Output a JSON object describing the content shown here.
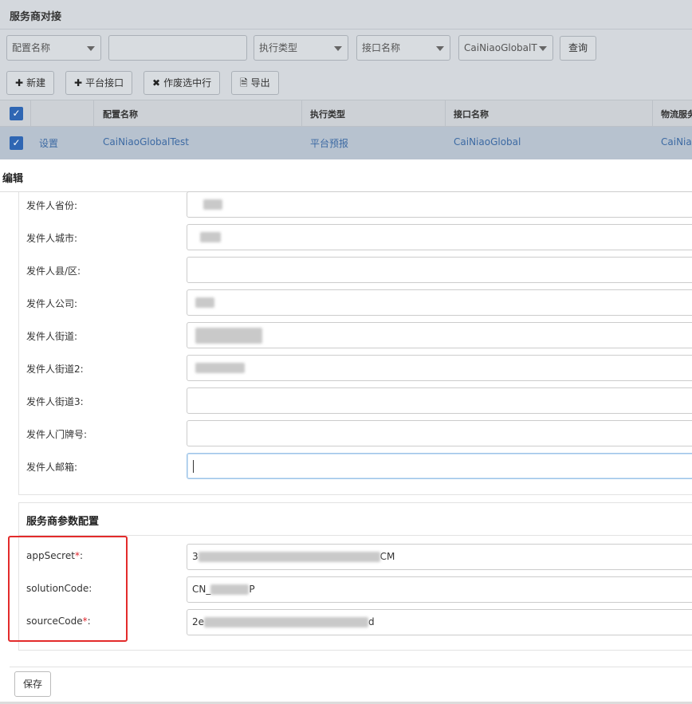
{
  "background": {
    "title": "服务商对接",
    "filters": {
      "config_name_select": "配置名称",
      "search_value": "",
      "exec_type_select": "执行类型",
      "api_name_select": "接口名称",
      "provider_select": "CaiNiaoGlobalT",
      "query_label": "查询"
    },
    "toolbar": {
      "new_label": "新建",
      "platform_api_label": "平台接口",
      "void_label": "作废选中行",
      "export_label": "导出"
    },
    "table": {
      "headers": [
        "配置名称",
        "执行类型",
        "接口名称",
        "物流服务"
      ],
      "row": {
        "action": "设置",
        "config_name": "CaiNiaoGlobalTest",
        "exec_type": "平台预报",
        "api_name": "CaiNiaoGlobal",
        "service": "CaiNia"
      }
    }
  },
  "modal": {
    "title": "编辑",
    "sender_fields": [
      {
        "label": "发件人省份:",
        "value": ""
      },
      {
        "label": "发件人城市:",
        "value": ""
      },
      {
        "label": "发件人县/区:",
        "value": ""
      },
      {
        "label": "发件人公司:",
        "value": ""
      },
      {
        "label": "发件人街道:",
        "value": ""
      },
      {
        "label": "发件人街道2:",
        "value": ""
      },
      {
        "label": "发件人街道3:",
        "value": ""
      },
      {
        "label": "发件人门牌号:",
        "value": ""
      },
      {
        "label": "发件人邮箱:",
        "value": ""
      }
    ],
    "provider_section": {
      "title": "服务商参数配置",
      "fields": [
        {
          "label": "appSecret",
          "required": "*",
          "colon": ":",
          "value_start": "3",
          "value_end": "CM"
        },
        {
          "label": "solutionCode",
          "required": "",
          "colon": ":",
          "value_start": "CN_",
          "value_end": "P"
        },
        {
          "label": "sourceCode",
          "required": "*",
          "colon": ":",
          "value_start": "2e",
          "value_end": "d"
        }
      ]
    },
    "save_label": "保存"
  },
  "colors": {
    "accent": "#2f66b3",
    "required": "#e0242b",
    "highlight_box": "#e32b2b"
  }
}
